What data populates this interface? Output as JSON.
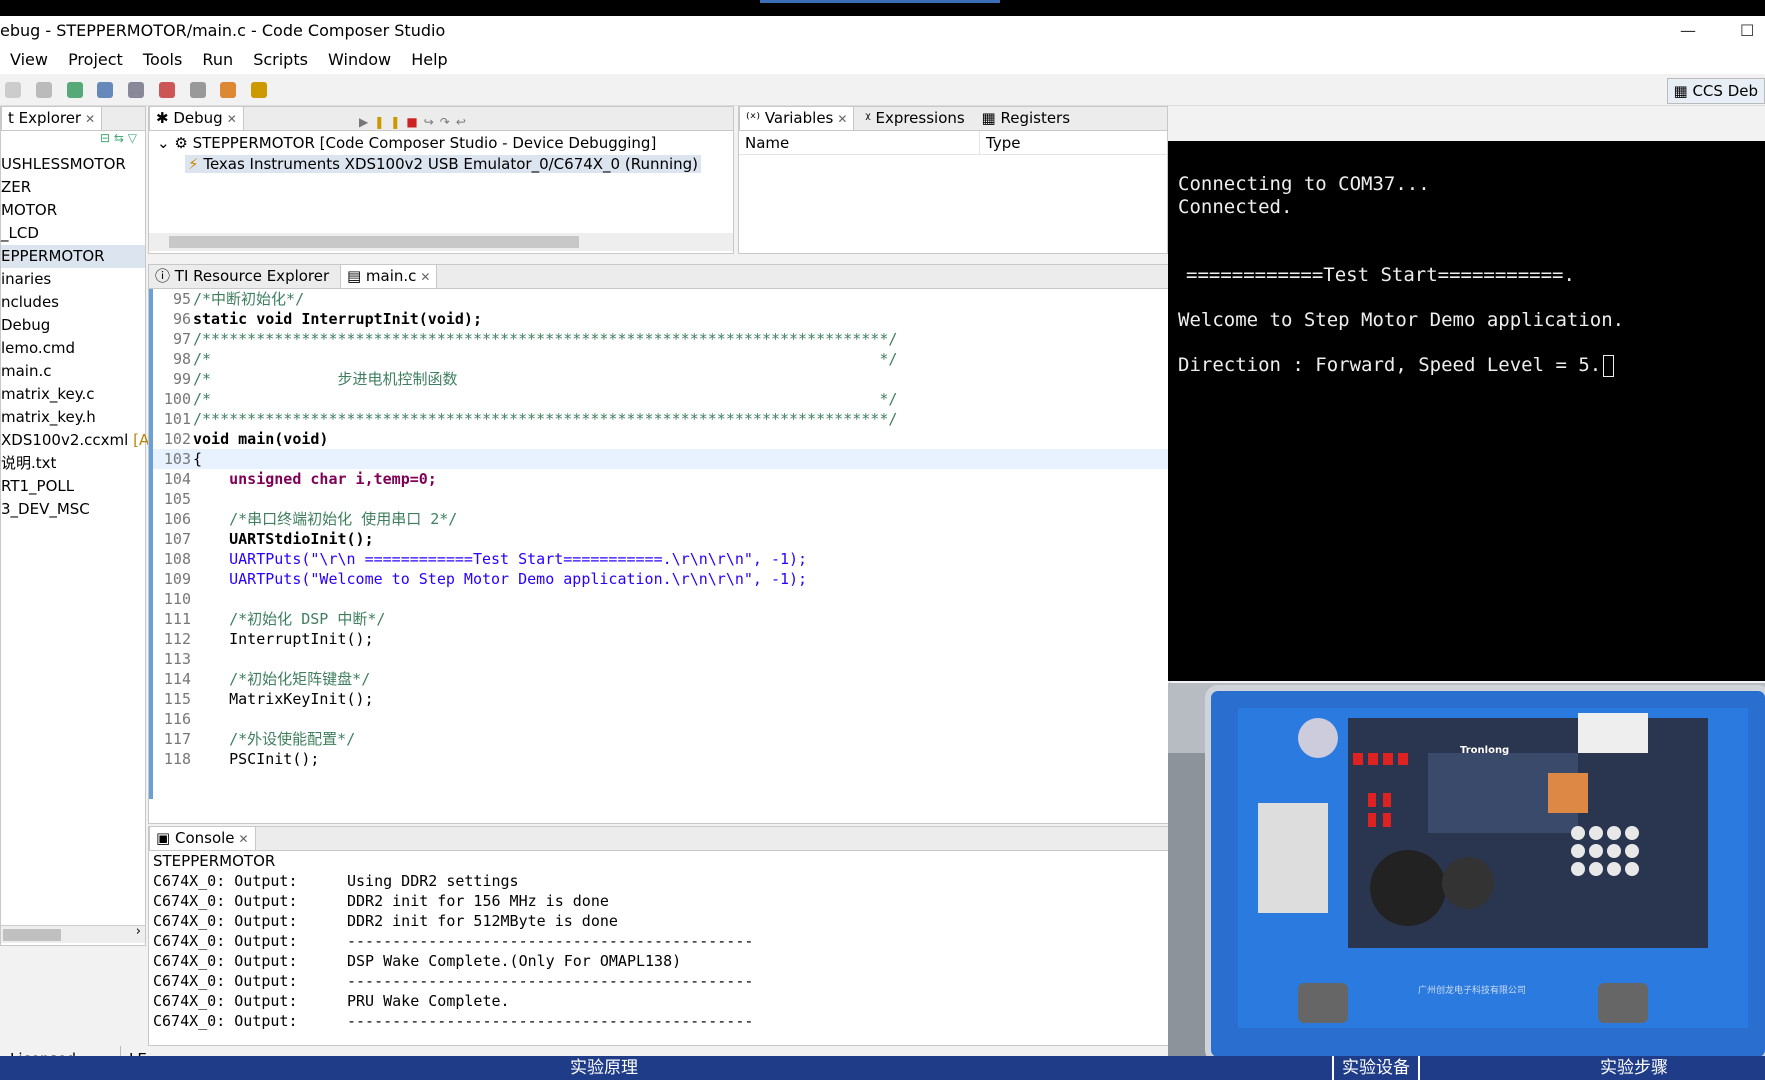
{
  "title": "ebug - STEPPERMOTOR/main.c - Code Composer Studio",
  "menu": [
    "View",
    "Project",
    "Tools",
    "Run",
    "Scripts",
    "Window",
    "Help"
  ],
  "perspective": "CCS Deb",
  "explorer": {
    "tab": "t Explorer",
    "items": [
      "USHLESSMOTOR",
      "ZER",
      "MOTOR",
      "_LCD",
      "EPPERMOTOR",
      "inaries",
      "ncludes",
      "Debug",
      "lemo.cmd",
      "main.c",
      "matrix_key.c",
      "matrix_key.h",
      "XDS100v2.ccxml",
      "说明.txt",
      "RT1_POLL",
      "3_DEV_MSC"
    ],
    "active_suffix": "[Ac"
  },
  "debug": {
    "tab": "Debug",
    "session": "STEPPERMOTOR [Code Composer Studio - Device Debugging]",
    "target": "Texas Instruments XDS100v2 USB Emulator_0/C674X_0 (Running)"
  },
  "variables": {
    "tabs": [
      "Variables",
      "Expressions",
      "Registers"
    ],
    "columns": [
      "Name",
      "Type"
    ]
  },
  "editor": {
    "tabs": [
      "TI Resource Explorer",
      "main.c"
    ],
    "lines": [
      {
        "n": "95",
        "t": "/*中断初始化*/",
        "k": "cm"
      },
      {
        "n": "96",
        "t": "static void InterruptInit(void);",
        "k": "decl"
      },
      {
        "n": "97",
        "t": "/****************************************************************************/",
        "k": "cm"
      },
      {
        "n": "98",
        "t": "/*                                                                          */",
        "k": "cm"
      },
      {
        "n": "99",
        "t": "/*              步进电机控制函数                                              ",
        "k": "cm"
      },
      {
        "n": "100",
        "t": "/*                                                                          */",
        "k": "cm"
      },
      {
        "n": "101",
        "t": "/****************************************************************************/",
        "k": "cm"
      },
      {
        "n": "102",
        "t": "void main(void)",
        "k": "main"
      },
      {
        "n": "103",
        "t": "{",
        "k": "plain"
      },
      {
        "n": "104",
        "t": "    unsigned char i,temp=0;",
        "k": "var"
      },
      {
        "n": "105",
        "t": "",
        "k": "plain"
      },
      {
        "n": "106",
        "t": "    /*串口终端初始化 使用串口 2*/",
        "k": "cm"
      },
      {
        "n": "107",
        "t": "    UARTStdioInit();",
        "k": "call"
      },
      {
        "n": "108",
        "t": "    UARTPuts(\"\\r\\n ============Test Start===========.\\r\\n\\r\\n\", -1);",
        "k": "puts"
      },
      {
        "n": "109",
        "t": "    UARTPuts(\"Welcome to Step Motor Demo application.\\r\\n\\r\\n\", -1);",
        "k": "puts"
      },
      {
        "n": "110",
        "t": "",
        "k": "plain"
      },
      {
        "n": "111",
        "t": "    /*初始化 DSP 中断*/",
        "k": "cm"
      },
      {
        "n": "112",
        "t": "    InterruptInit();",
        "k": "plain"
      },
      {
        "n": "113",
        "t": "",
        "k": "plain"
      },
      {
        "n": "114",
        "t": "    /*初始化矩阵键盘*/",
        "k": "cm"
      },
      {
        "n": "115",
        "t": "    MatrixKeyInit();",
        "k": "plain"
      },
      {
        "n": "116",
        "t": "",
        "k": "plain"
      },
      {
        "n": "117",
        "t": "    /*外设使能配置*/",
        "k": "cm"
      },
      {
        "n": "118",
        "t": "    PSCInit();",
        "k": "plain"
      }
    ]
  },
  "console": {
    "tab": "Console",
    "project": "STEPPERMOTOR",
    "lines": [
      [
        "C674X_0: Output:",
        "Using DDR2 settings"
      ],
      [
        "C674X_0: Output:",
        "DDR2 init for 156 MHz is done"
      ],
      [
        "C674X_0: Output:",
        "DDR2 init for 512MByte is done"
      ],
      [
        "C674X_0: Output:",
        "---------------------------------------------"
      ],
      [
        "C674X_0: Output:",
        "DSP Wake Complete.(Only For OMAPL138)"
      ],
      [
        "C674X_0: Output:",
        "---------------------------------------------"
      ],
      [
        "C674X_0: Output:",
        "PRU Wake Complete."
      ],
      [
        "C674X_0: Output:",
        "---------------------------------------------"
      ]
    ]
  },
  "status": {
    "license": "Licensed",
    "mode": "LE"
  },
  "terminal": {
    "lines": [
      "Connecting to COM37...",
      "Connected.",
      "",
      "",
      "============Test Start===========.",
      "",
      "Welcome to Step Motor Demo application.",
      "",
      "Direction : Forward, Speed Level = 5."
    ]
  },
  "board": {
    "brand": "Tronlong",
    "maker": "广州创龙电子科技有限公司"
  },
  "bottombar": {
    "left": "实验原理",
    "mid": "实验设备",
    "right": "实验步骤"
  }
}
